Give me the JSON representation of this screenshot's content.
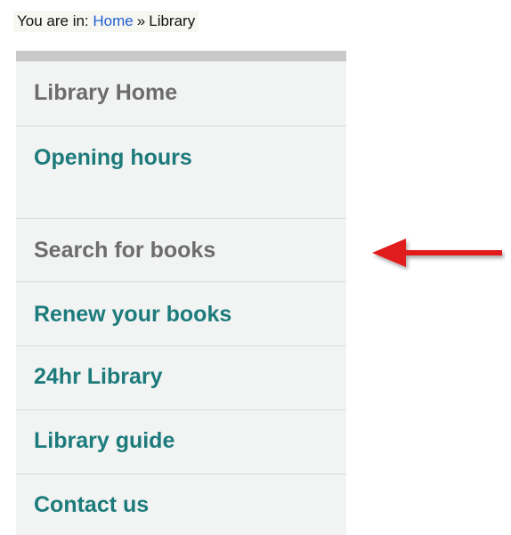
{
  "breadcrumb": {
    "prefix": "You are in:",
    "home_link": "Home",
    "separator": "»",
    "current": "Library"
  },
  "nav": {
    "items": [
      {
        "label": "Library Home",
        "muted": true
      },
      {
        "label": "Opening hours",
        "muted": false
      },
      {
        "label": "Search for books",
        "muted": true
      },
      {
        "label": "Renew your books",
        "muted": false
      },
      {
        "label": "24hr Library",
        "muted": false
      },
      {
        "label": "Library guide",
        "muted": false
      },
      {
        "label": "Contact us",
        "muted": false
      }
    ]
  },
  "annotation": {
    "icon": "arrow-left-icon",
    "color": "#e11d1d"
  },
  "colors": {
    "nav_background": "#f2f3f3",
    "nav_top_border": "#c9c9c9",
    "link_teal": "#1d7b7b",
    "muted_grey": "#6c6c6c",
    "breadcrumb_link": "#1f5fcf"
  }
}
